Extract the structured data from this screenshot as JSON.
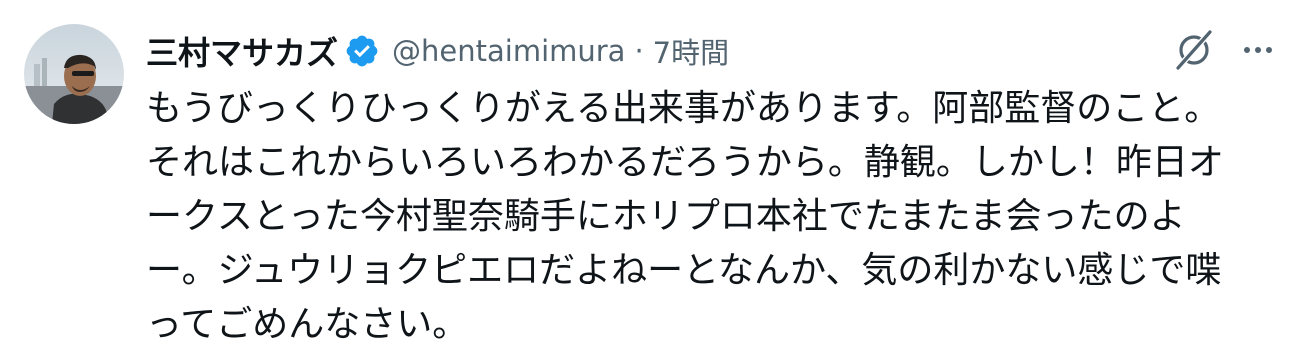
{
  "tweet": {
    "display_name": "三村マサカズ",
    "handle": "@hentaimimura",
    "separator": "·",
    "timestamp": "7時間",
    "lines": [
      "もうびっくりひっくりがえる出来事があります。阿部監督のこと。",
      "それはこれからいろいろわかるだろうから。静観。しかし！昨日オ",
      "ークスとった今村聖奈騎手にホリプロ本社でたまたま会ったのよ",
      "ー。ジュウリョクピエロだよねーとなんか、気の利かない感じで喋",
      "ってごめんなさい。"
    ]
  },
  "icons": {
    "avatar": "avatar",
    "verified": "verified-badge-icon",
    "grok": "grok-icon",
    "more": "more-icon"
  },
  "colors": {
    "verified": "#1d9bf0",
    "secondary_text": "#536471",
    "primary_text": "#0f1419",
    "background": "#ffffff"
  }
}
